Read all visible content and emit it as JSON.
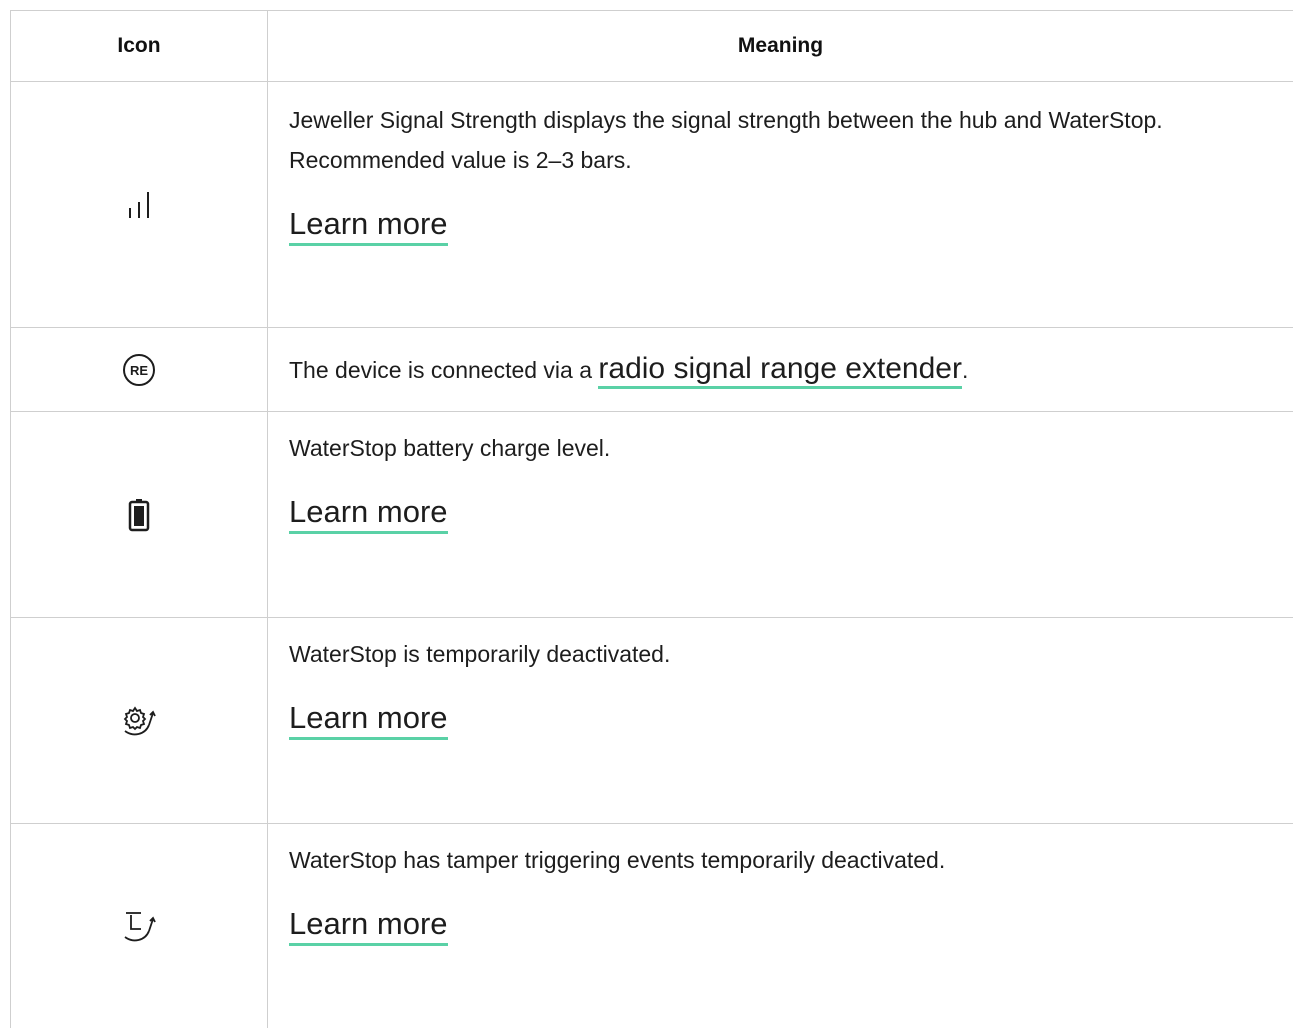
{
  "table": {
    "headers": {
      "icon": "Icon",
      "meaning": "Meaning"
    },
    "rows": [
      {
        "icon": "signal-strength-icon",
        "description": "Jeweller Signal Strength displays the signal strength between the hub and WaterStop. Recommended value is 2–3 bars.",
        "link": "Learn more"
      },
      {
        "icon": "range-extender-icon",
        "icon_label": "RE",
        "description_before": "The device is connected via a ",
        "link": "radio signal range extender",
        "description_after": "."
      },
      {
        "icon": "battery-icon",
        "description": "WaterStop battery charge level.",
        "link": "Learn more"
      },
      {
        "icon": "gear-deactivated-icon",
        "description": "WaterStop is temporarily deactivated.",
        "link": "Learn more"
      },
      {
        "icon": "tamper-deactivated-icon",
        "description": "WaterStop has tamper triggering events temporarily deactivated.",
        "link": "Learn more"
      }
    ]
  },
  "colors": {
    "link_underline": "#5ad1a6",
    "border": "#cfcfcf",
    "text": "#1d1d1d"
  }
}
